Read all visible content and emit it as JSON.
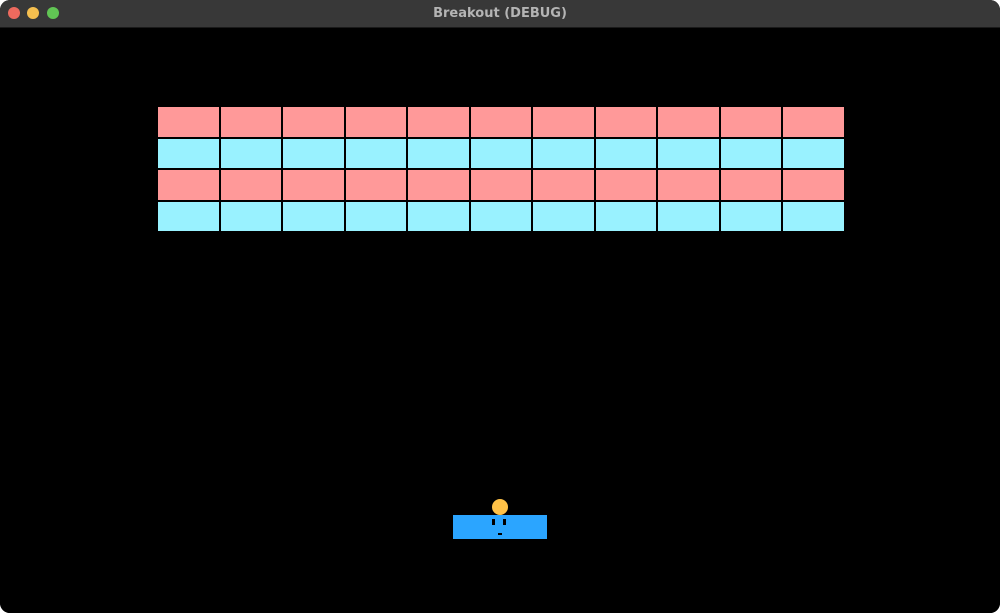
{
  "window": {
    "title": "Breakout (DEBUG)",
    "controls": {
      "close_color": "#ed6a5e",
      "minimize_color": "#f5bf4f",
      "zoom_color": "#61c554"
    }
  },
  "game": {
    "background_color": "#000000",
    "bricks": {
      "columns": 11,
      "rows": [
        {
          "color": "#ff9999"
        },
        {
          "color": "#99f2ff"
        },
        {
          "color": "#ff9999"
        },
        {
          "color": "#99f2ff"
        }
      ]
    },
    "paddle": {
      "color": "#2ba5ff"
    },
    "ball": {
      "color": "#ffc247"
    }
  }
}
